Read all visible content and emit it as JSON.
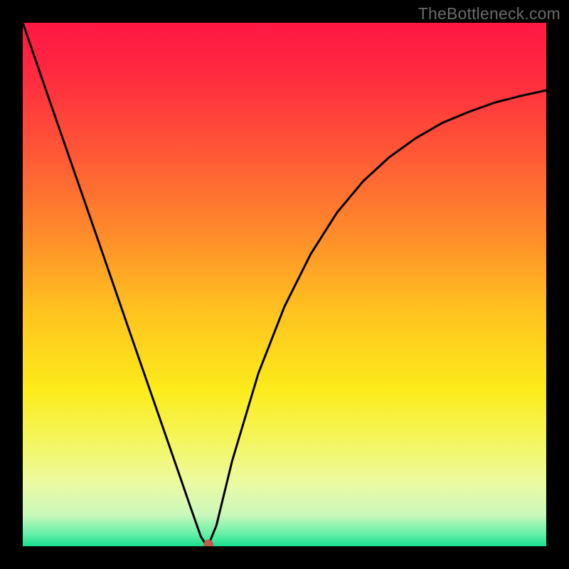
{
  "watermark": "TheBottleneck.com",
  "chart_data": {
    "type": "line",
    "title": "",
    "xlabel": "",
    "ylabel": "",
    "xlim": [
      0,
      1
    ],
    "ylim": [
      0,
      1
    ],
    "gradient_colors": [
      {
        "stop": 0.0,
        "color": "#ff1744"
      },
      {
        "stop": 0.1,
        "color": "#ff2b3f"
      },
      {
        "stop": 0.25,
        "color": "#ff5836"
      },
      {
        "stop": 0.4,
        "color": "#ff8a2b"
      },
      {
        "stop": 0.55,
        "color": "#ffc21f"
      },
      {
        "stop": 0.7,
        "color": "#fceb1a"
      },
      {
        "stop": 0.8,
        "color": "#f4f65e"
      },
      {
        "stop": 0.88,
        "color": "#ecfaa3"
      },
      {
        "stop": 0.94,
        "color": "#c9f8ba"
      },
      {
        "stop": 0.975,
        "color": "#6af0a9"
      },
      {
        "stop": 1.0,
        "color": "#18e08e"
      }
    ],
    "curve": {
      "x": [
        0.0,
        0.05,
        0.1,
        0.15,
        0.2,
        0.25,
        0.275,
        0.3,
        0.32,
        0.34,
        0.35,
        0.355,
        0.37,
        0.4,
        0.45,
        0.5,
        0.55,
        0.6,
        0.65,
        0.7,
        0.75,
        0.8,
        0.85,
        0.9,
        0.95,
        1.0
      ],
      "y": [
        1.0,
        0.855,
        0.711,
        0.567,
        0.422,
        0.278,
        0.206,
        0.134,
        0.076,
        0.019,
        0.003,
        0.003,
        0.04,
        0.163,
        0.33,
        0.458,
        0.558,
        0.637,
        0.697,
        0.743,
        0.779,
        0.808,
        0.829,
        0.847,
        0.86,
        0.871
      ]
    },
    "marker": {
      "x": 0.355,
      "y": 0.003,
      "color": "#c1594f",
      "radius_px": 7
    }
  }
}
